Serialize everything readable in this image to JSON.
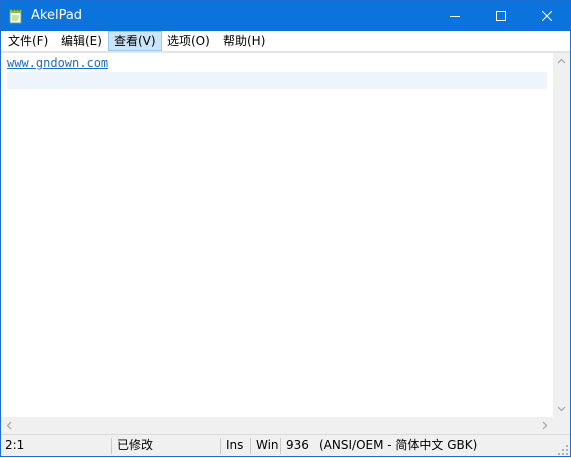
{
  "window": {
    "title": "AkelPad",
    "controls": {
      "minimize_icon": "minimize-icon",
      "maximize_icon": "maximize-icon",
      "close_icon": "close-icon"
    }
  },
  "menu": {
    "items": [
      {
        "label": "文件(F)"
      },
      {
        "label": "编辑(E)"
      },
      {
        "label": "查看(V)",
        "active": true
      },
      {
        "label": "选项(O)"
      },
      {
        "label": "帮助(H)"
      }
    ]
  },
  "editor": {
    "lines": [
      "www.gndown.com",
      ""
    ]
  },
  "status": {
    "position": "2:1",
    "modified": "已修改",
    "insert_mode": "Ins",
    "newline": "Win",
    "codepage": "936",
    "encoding_name": "(ANSI/OEM - 简体中文 GBK)"
  },
  "colors": {
    "titlebar": "#0a74dc",
    "link": "#1c6fc0",
    "current_line": "#eef4fb",
    "menu_active": "#cce4f7"
  }
}
